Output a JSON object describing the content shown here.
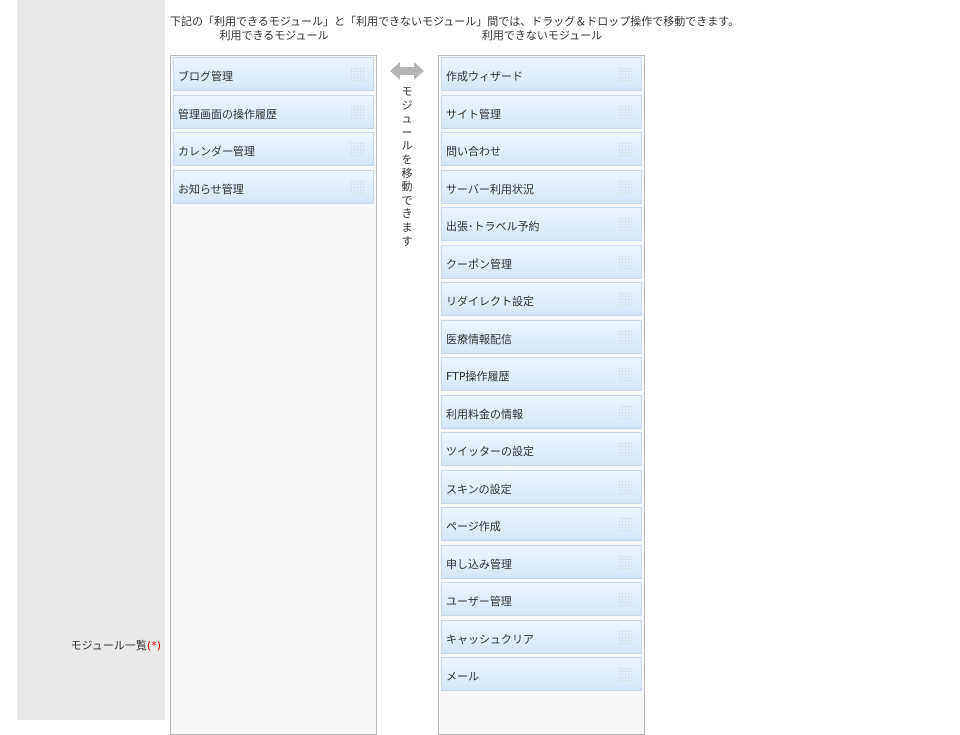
{
  "field": {
    "label": "モジュール一覧",
    "required_mark": "(*)"
  },
  "instruction": "下記の「利用できるモジュール」と「利用できないモジュール」間では、ドラッグ＆ドロップ操作で移動できます。",
  "available": {
    "heading": "利用できるモジュール",
    "items": [
      "ブログ管理",
      "管理画面の操作履歴",
      "カレンダー管理",
      "お知らせ管理"
    ]
  },
  "unavailable": {
    "heading": "利用できないモジュール",
    "items": [
      "作成ウィザード",
      "サイト管理",
      "問い合わせ",
      "サーバー利用状況",
      "出張･トラベル予約",
      "クーポン管理",
      "リダイレクト設定",
      "医療情報配信",
      "FTP操作履歴",
      "利用料金の情報",
      "ツイッターの設定",
      "スキンの設定",
      "ページ作成",
      "申し込み管理",
      "ユーザー管理",
      "キャッシュクリア",
      "メール"
    ]
  },
  "middle": {
    "text": "モジュールを移動できます",
    "icon": "double-arrow-icon",
    "icon_color": "#b5b5b5"
  },
  "colors": {
    "item_gradient_top": "#eef5fc",
    "item_gradient_bottom": "#d6e6f7",
    "label_column_bg": "#e9e9e9",
    "required": "#d00000"
  }
}
